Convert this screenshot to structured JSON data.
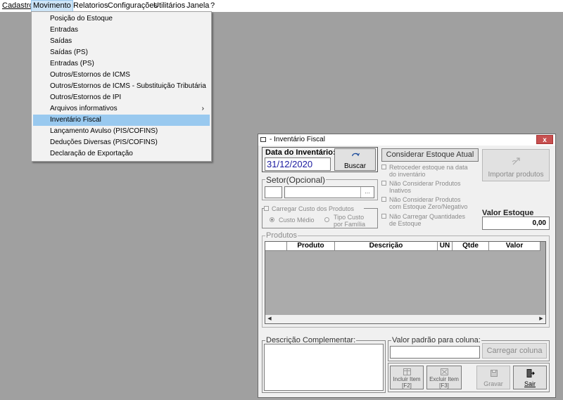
{
  "menubar": {
    "items": [
      "Cadastros",
      "Movimento",
      "Relatorios",
      "Configurações",
      "Utilitários",
      "Janela",
      "?"
    ]
  },
  "dropdown": {
    "items": [
      "Posição do Estoque",
      "Entradas",
      "Saídas",
      "Saídas (PS)",
      "Entradas (PS)",
      "Outros/Estornos de ICMS",
      "Outros/Estornos de ICMS - Substituição Tributária",
      "Outros/Estornos de IPI",
      "Arquivos informativos",
      "Inventário Fiscal",
      "Lançamento Avulso (PIS/COFINS)",
      "Deduções Diversas (PIS/COFINS)",
      "Declaração de Exportação"
    ],
    "submenu_arrow": "›"
  },
  "window": {
    "title": "- Inventário Fiscal",
    "close": "x",
    "data_label": "Data do Inventário:",
    "data_value": "31/12/2020",
    "buscar": "Buscar",
    "considerar": "Considerar Estoque Atual",
    "retroceder": [
      "Retroceder estoque na data",
      "do inventário"
    ],
    "nao_inativos": [
      "Não Considerar Produtos",
      "Inativos"
    ],
    "nao_zero": [
      "Não Considerar Produtos",
      "com Estoque Zero/Negativo"
    ],
    "nao_carregar": [
      "Não Carregar Quantidades",
      "de Estoque"
    ],
    "importar": "Importar produtos",
    "setor_label": "Setor(Opcional)",
    "ellipsis": "...",
    "carregar_custo": "Carregar Custo dos Produtos",
    "custo_medio": "Custo Médio",
    "tipo_custo": [
      "Tipo Custo",
      "por Família"
    ],
    "valor_estoque_label": "Valor Estoque",
    "valor_estoque": "0,00",
    "produtos_label": "Produtos",
    "columns": [
      "",
      "Produto",
      "Descrição",
      "UN",
      "Qtde",
      "Valor"
    ],
    "desc_label": "Descrição Complementar:",
    "valor_padrao_label": "Valor padrão para coluna:",
    "carregar_coluna": "Carregar coluna",
    "incluir": [
      "Incluir Item",
      "[F2]"
    ],
    "excluir": [
      "Excluir Item",
      "[F3]"
    ],
    "gravar": "Gravar",
    "sair": "Sair"
  }
}
